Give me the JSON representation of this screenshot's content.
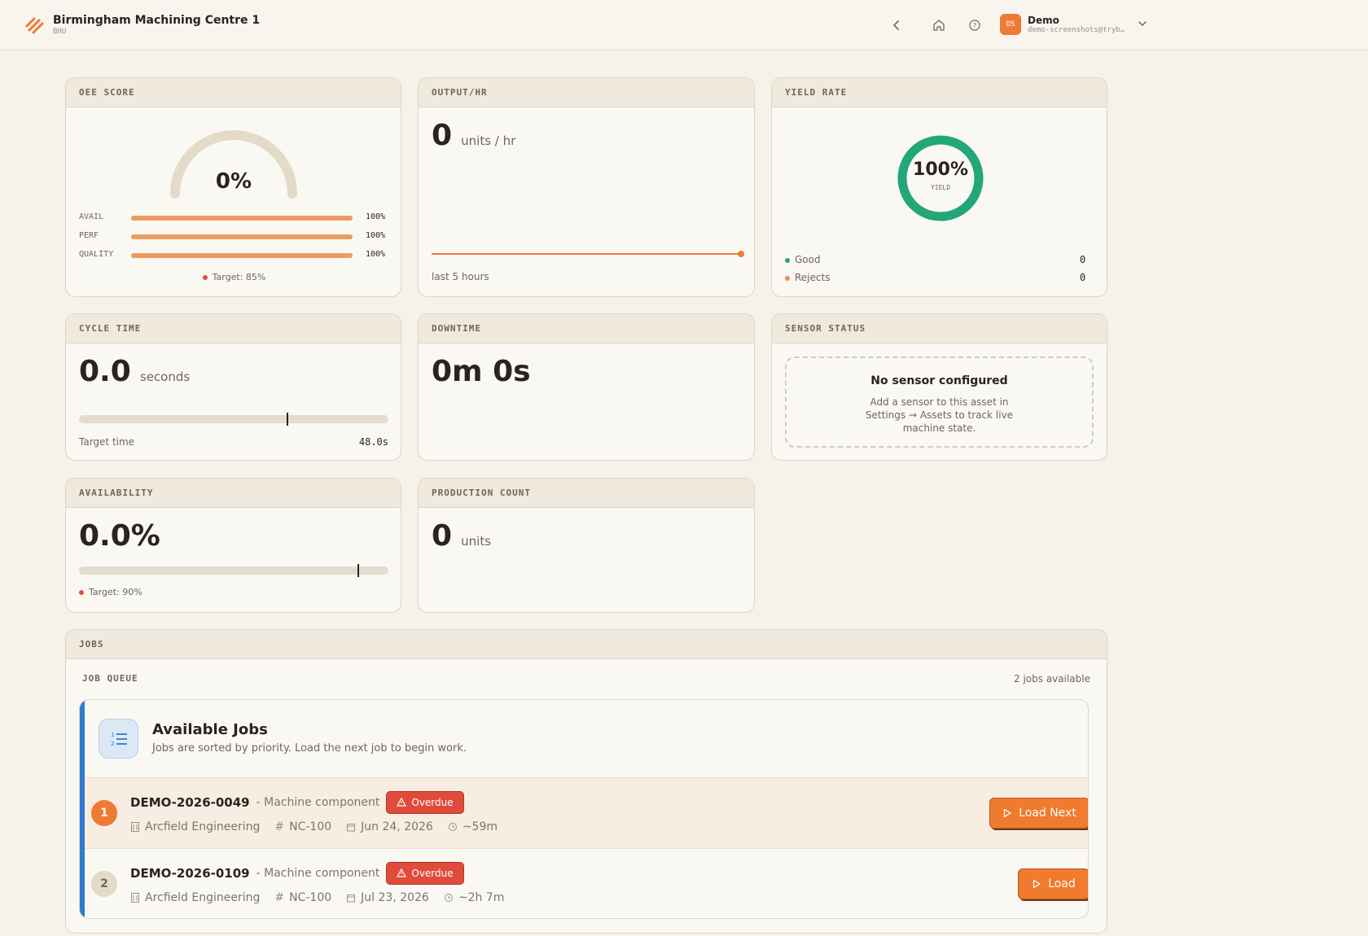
{
  "header": {
    "title": "Birmingham Machining Centre 1",
    "subtitle": "BHU",
    "user": {
      "initials": "DS",
      "name": "Demo",
      "email": "demo-screenshots@tryb…"
    },
    "accent": "#ee7a34"
  },
  "oee": {
    "title": "OEE SCORE",
    "score": "0%",
    "score_value": 0,
    "bars": [
      {
        "label": "AVAIL",
        "value": "100%",
        "fraction": 1.0
      },
      {
        "label": "PERF",
        "value": "100%",
        "fraction": 1.0
      },
      {
        "label": "QUALITY",
        "value": "100%",
        "fraction": 1.0
      }
    ],
    "target": "Target: 85%"
  },
  "output": {
    "title": "OUTPUT/HR",
    "value": "0",
    "unit": "units / hr",
    "caption": "last 5 hours"
  },
  "yield": {
    "title": "YIELD RATE",
    "value": "100%",
    "label": "YIELD",
    "fraction": 1.0,
    "good_label": "Good",
    "good_value": "0",
    "rejects_label": "Rejects",
    "rejects_value": "0",
    "color": "#22a77a"
  },
  "cycle": {
    "title": "CYCLE TIME",
    "value": "0.0",
    "unit": "seconds",
    "target_label": "Target time",
    "target_value": "48.0s",
    "marker_fraction": 0.67
  },
  "downtime": {
    "title": "DOWNTIME",
    "value": "0m 0s"
  },
  "sensor": {
    "title": "SENSOR STATUS",
    "heading": "No sensor configured",
    "body": "Add a sensor to this asset in Settings → Assets to track live machine state."
  },
  "availability": {
    "title": "AVAILABILITY",
    "value": "0.0%",
    "target": "Target: 90%",
    "marker_fraction": 0.9
  },
  "production": {
    "title": "PRODUCTION COUNT",
    "value": "0",
    "unit": "units"
  },
  "jobs": {
    "title": "JOBS",
    "queue_label": "JOB QUEUE",
    "available_count": "2 jobs available",
    "panel_title": "Available Jobs",
    "panel_desc": "Jobs are sorted by priority. Load the next job to begin work.",
    "items": [
      {
        "rank": "1",
        "id": "DEMO-2026-0049",
        "desc": "- Machine component",
        "status": "Overdue",
        "customer": "Arcfield Engineering",
        "part": "NC-100",
        "date": "Jun 24, 2026",
        "duration": "~59m",
        "action": "Load Next"
      },
      {
        "rank": "2",
        "id": "DEMO-2026-0109",
        "desc": "- Machine component",
        "status": "Overdue",
        "customer": "Arcfield Engineering",
        "part": "NC-100",
        "date": "Jul 23, 2026",
        "duration": "~2h 7m",
        "action": "Load"
      }
    ]
  }
}
